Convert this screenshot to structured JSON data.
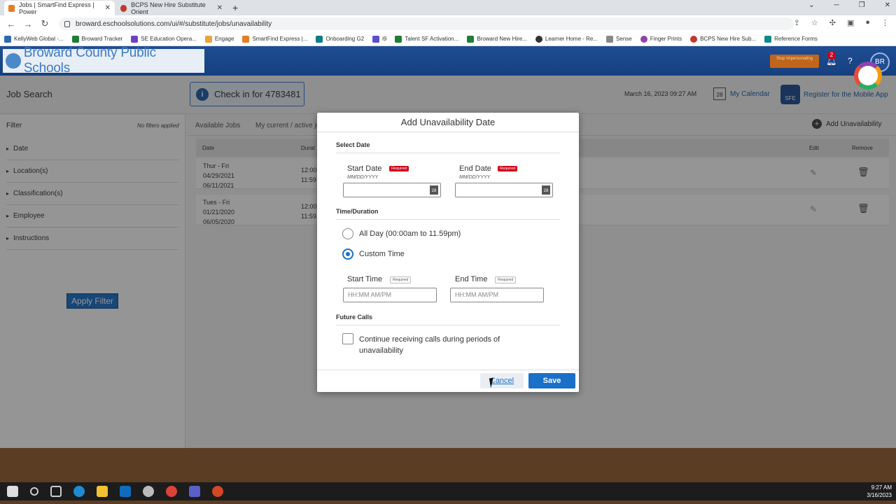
{
  "browser": {
    "tabs": [
      {
        "title": "Jobs | SmartFind Express | Power",
        "close": "✕"
      },
      {
        "title": "BCPS New Hire Substitute Orient",
        "close": "✕"
      }
    ],
    "newtab": "+",
    "url": "broward.eschoolsolutions.com/ui/#/substitute/jobs/unavailability",
    "bookmarks": [
      "KellyWeb Global -...",
      "Broward Tracker",
      "SE Education Opera...",
      "Engage",
      "SmartFind Express |...",
      "Onboarding G2",
      "i9",
      "Talent SF Activation...",
      "Broward New Hire...",
      "Learner Home - Re...",
      "Sense",
      "Finger Prints",
      "BCPS New Hire Sub...",
      "Reference Forms"
    ]
  },
  "header": {
    "logo_text": "Broward County Public Schools",
    "stop_impersonating": "Stop Impersonating",
    "notification_count": "2",
    "help": "?",
    "avatar_initials": "BR"
  },
  "topbar": {
    "page_title": "Job Search",
    "checkin_label": "Check in for 4783481",
    "datetime": "March 16, 2023 09:27 AM",
    "calendar_day": "28",
    "my_calendar": "My Calendar",
    "sfe_label": "SFE",
    "register_mobile": "Register for the Mobile App"
  },
  "sidebar": {
    "filter_label": "Filter",
    "no_filters": "No filters applied",
    "items": [
      "Date",
      "Location(s)",
      "Classification(s)",
      "Employee",
      "Instructions"
    ],
    "apply_button": "Apply Filter"
  },
  "content": {
    "tabs": [
      "Available Jobs",
      "My current / active jo"
    ],
    "add_unavailability": "Add Unavailability",
    "columns": {
      "date": "Date",
      "duration": "Durat",
      "edit": "Edit",
      "remove": "Remove"
    },
    "rows": [
      {
        "days": "Thur - Fri",
        "start": "04/29/2021",
        "end": "06/11/2021",
        "t1": "12:00",
        "t2": "11:59"
      },
      {
        "days": "Tues - Fri",
        "start": "01/21/2020",
        "end": "06/05/2020",
        "t1": "12:00",
        "t2": "11:59"
      }
    ]
  },
  "modal": {
    "title": "Add Unavailability Date",
    "select_date": "Select Date",
    "start_date_label": "Start Date",
    "end_date_label": "End Date",
    "required": "Required",
    "date_hint": "MM/DD/YYYY",
    "calendar_num": "28",
    "time_duration": "Time/Duration",
    "all_day": "All Day (00:00am to 11.59pm)",
    "custom_time": "Custom Time",
    "start_time_label": "Start Time",
    "end_time_label": "End Time",
    "time_placeholder": "HH:MM AM/PM",
    "future_calls": "Future Calls",
    "continue_calls": "Continue receiving calls during periods of unavailability",
    "cancel": "Cancel",
    "save": "Save"
  },
  "taskbar": {
    "time": "9:27 AM",
    "date": "3/16/2023"
  },
  "colors": {
    "brand_blue": "#1f4e94",
    "accent": "#1a6fc9",
    "required_red": "#d0021b"
  }
}
